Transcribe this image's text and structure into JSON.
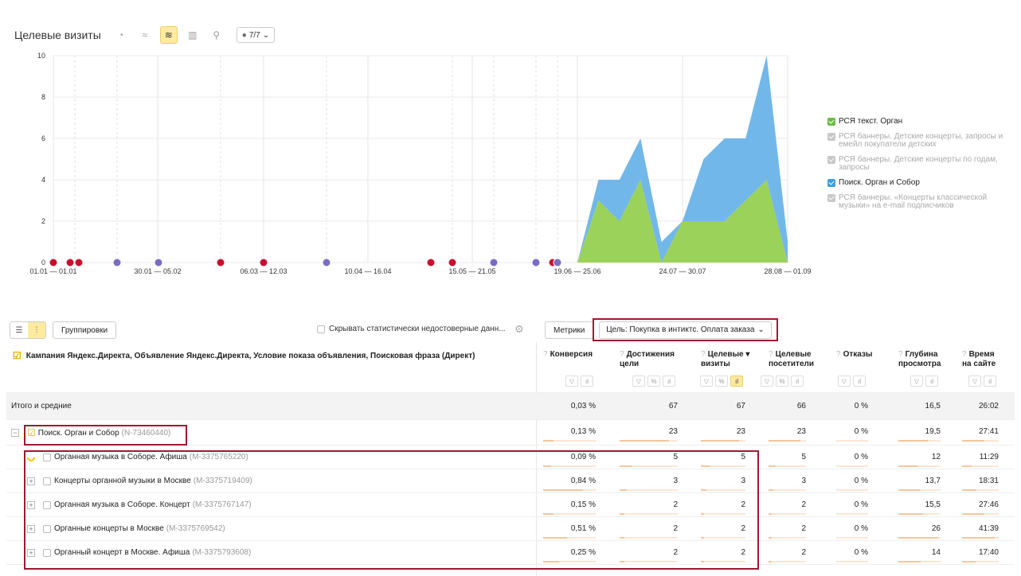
{
  "chart_header": {
    "title": "Целевые визиты",
    "tools": [
      {
        "name": "pie-chart-icon",
        "glyph": "◔",
        "active": false
      },
      {
        "name": "line-chart-icon",
        "glyph": "≈",
        "active": false
      },
      {
        "name": "area-chart-icon",
        "glyph": "≋",
        "active": true
      },
      {
        "name": "bar-chart-icon",
        "glyph": "▥",
        "active": false
      },
      {
        "name": "map-pin-icon",
        "glyph": "⚲",
        "active": false
      }
    ],
    "notes_label": "7/7"
  },
  "chart_data": {
    "type": "area",
    "stacked": true,
    "title": "",
    "xlabel": "",
    "ylabel": "",
    "ylim": [
      0,
      10
    ],
    "yticks": [
      0,
      2,
      4,
      6,
      8,
      10
    ],
    "x_tick_labels": [
      "01.01 — 01.01",
      "30.01 — 05.02",
      "06.03 — 12.03",
      "10.04 — 16.04",
      "15.05 — 21.05",
      "19.06 — 25.06",
      "24.07 — 30.07",
      "28.08 — 01.09"
    ],
    "categories": [
      "19.06 — 25.06",
      "",
      "",
      "",
      "",
      "24.07 — 30.07",
      "",
      "",
      "",
      "",
      "28.08 — 01.09"
    ],
    "series": [
      {
        "name": "РСЯ текст. Орган",
        "color": "#9bd25a",
        "values": [
          0,
          3,
          2,
          4,
          0,
          2,
          2,
          2,
          3,
          4,
          0
        ]
      },
      {
        "name": "Поиск. Орган и Собор",
        "color": "#72b7ea",
        "values": [
          0,
          1,
          2,
          2,
          1,
          0,
          3,
          4,
          3,
          6,
          1
        ]
      }
    ],
    "grid": true,
    "legend_position": "right"
  },
  "legend": [
    {
      "label": "РСЯ текст. Орган",
      "color": "#6cbd45",
      "muted": false
    },
    {
      "label": "РСЯ баннеры. Детские концерты, запросы и емейл покупатели детских",
      "color": "#c8c8c8",
      "muted": true
    },
    {
      "label": "РСЯ баннеры. Детские концерты по годам, запросы",
      "color": "#c8c8c8",
      "muted": true
    },
    {
      "label": "Поиск. Орган и Собор",
      "color": "#3d9fe0",
      "muted": false
    },
    {
      "label": "РСЯ баннеры. «Концерты классической музыки» на e-mail подписчиков",
      "color": "#c8c8c8",
      "muted": true
    }
  ],
  "toolbar": {
    "groupings_label": "Группировки",
    "hide_unreliable_label": "Скрывать статистически недостоверные данн...",
    "metrics_label": "Метрики",
    "goal_label": "Цель: Покупка в интиктс. Оплата заказа"
  },
  "table": {
    "dimension_header": "Кампания Яндекс.Директа, Объявление Яндекс.Директа, Условие показа объявления, Поисковая фраза (Директ)",
    "columns": [
      {
        "line1": "Конверсия",
        "line2": ""
      },
      {
        "line1": "Достижения",
        "line2": "цели"
      },
      {
        "line1": "Целевые ▾",
        "line2": "визиты"
      },
      {
        "line1": "Целевые",
        "line2": "посетители"
      },
      {
        "line1": "Отказы",
        "line2": ""
      },
      {
        "line1": "Глубина",
        "line2": "просмотра"
      },
      {
        "line1": "Время",
        "line2": "на сайте"
      }
    ],
    "total": {
      "label": "Итого и средние",
      "values": [
        "0,03 %",
        "67",
        "67",
        "66",
        "0 %",
        "16,5",
        "26:02"
      ]
    },
    "campaign": {
      "label": "Поиск. Орган и Собор",
      "id": "(N-73460440)",
      "values": [
        "0,13 %",
        "23",
        "23",
        "23",
        "0 %",
        "19,5",
        "27:41"
      ],
      "bars": [
        0.2,
        0.85,
        0.85,
        0.85,
        0,
        0.7,
        0.6
      ]
    },
    "rows": [
      {
        "label": "Органная музыка в Соборе. Афиша",
        "id": "(M-3375765220)",
        "values": [
          "0,09 %",
          "5",
          "5",
          "5",
          "0 %",
          "12",
          "11:29"
        ],
        "bars": [
          0.15,
          0.2,
          0.2,
          0.2,
          0,
          0.45,
          0.25
        ],
        "loading": true
      },
      {
        "label": "Концерты органной музыки в Москве",
        "id": "(M-3375719409)",
        "values": [
          "0,84 %",
          "3",
          "3",
          "3",
          "0 %",
          "13,7",
          "18:31"
        ],
        "bars": [
          0.75,
          0.12,
          0.12,
          0.12,
          0,
          0.5,
          0.4
        ],
        "loading": false
      },
      {
        "label": "Органная музыка в Соборе. Концерт",
        "id": "(M-3375767147)",
        "values": [
          "0,15 %",
          "2",
          "2",
          "2",
          "0 %",
          "15,5",
          "27:46"
        ],
        "bars": [
          0.2,
          0.08,
          0.08,
          0.08,
          0,
          0.58,
          0.6
        ],
        "loading": false
      },
      {
        "label": "Органные концерты в Москве",
        "id": "(M-3375769542)",
        "values": [
          "0,51 %",
          "2",
          "2",
          "2",
          "0 %",
          "26",
          "41:39"
        ],
        "bars": [
          0.45,
          0.08,
          0.08,
          0.08,
          0,
          0.95,
          0.9
        ],
        "loading": false
      },
      {
        "label": "Органный концерт в Москве. Афиша",
        "id": "(M-3375793608)",
        "values": [
          "0,25 %",
          "2",
          "2",
          "2",
          "0 %",
          "14",
          "17:40"
        ],
        "bars": [
          0.3,
          0.08,
          0.08,
          0.08,
          0,
          0.52,
          0.38
        ],
        "loading": false
      }
    ]
  }
}
